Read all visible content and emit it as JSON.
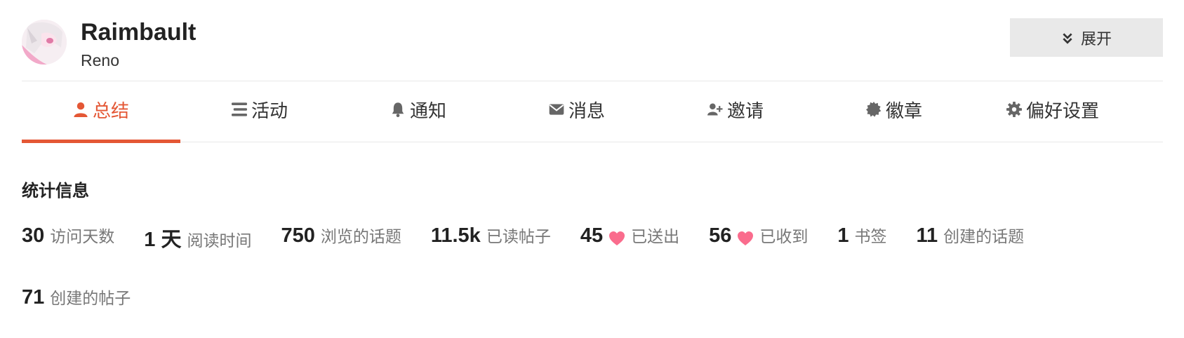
{
  "user": {
    "name": "Raimbault",
    "username": "Reno",
    "expand_label": "展开"
  },
  "nav": {
    "tabs": [
      {
        "label": "总结",
        "icon": "user-icon",
        "active": true
      },
      {
        "label": "活动",
        "icon": "stream-icon",
        "active": false
      },
      {
        "label": "通知",
        "icon": "bell-icon",
        "active": false
      },
      {
        "label": "消息",
        "icon": "envelope-icon",
        "active": false
      },
      {
        "label": "邀请",
        "icon": "user-plus-icon",
        "active": false
      },
      {
        "label": "徽章",
        "icon": "badge-certificate-icon",
        "active": false
      },
      {
        "label": "偏好设置",
        "icon": "gear-icon",
        "active": false
      }
    ]
  },
  "stats": {
    "title": "统计信息",
    "items": [
      {
        "value": "30",
        "label": "访问天数"
      },
      {
        "value": "1 天",
        "label": "阅读时间"
      },
      {
        "value": "750",
        "label": "浏览的话题"
      },
      {
        "value": "11.5k",
        "label": "已读帖子"
      },
      {
        "value": "45",
        "label": "已送出",
        "icon": "heart-icon"
      },
      {
        "value": "56",
        "label": "已收到",
        "icon": "heart-icon"
      },
      {
        "value": "1",
        "label": "书签"
      },
      {
        "value": "11",
        "label": "创建的话题"
      },
      {
        "value": "71",
        "label": "创建的帖子"
      }
    ]
  },
  "colors": {
    "accent": "#e45735",
    "heart": "#fa6c8d",
    "muted_text": "#777777",
    "button_bg": "#e9e9e9"
  }
}
